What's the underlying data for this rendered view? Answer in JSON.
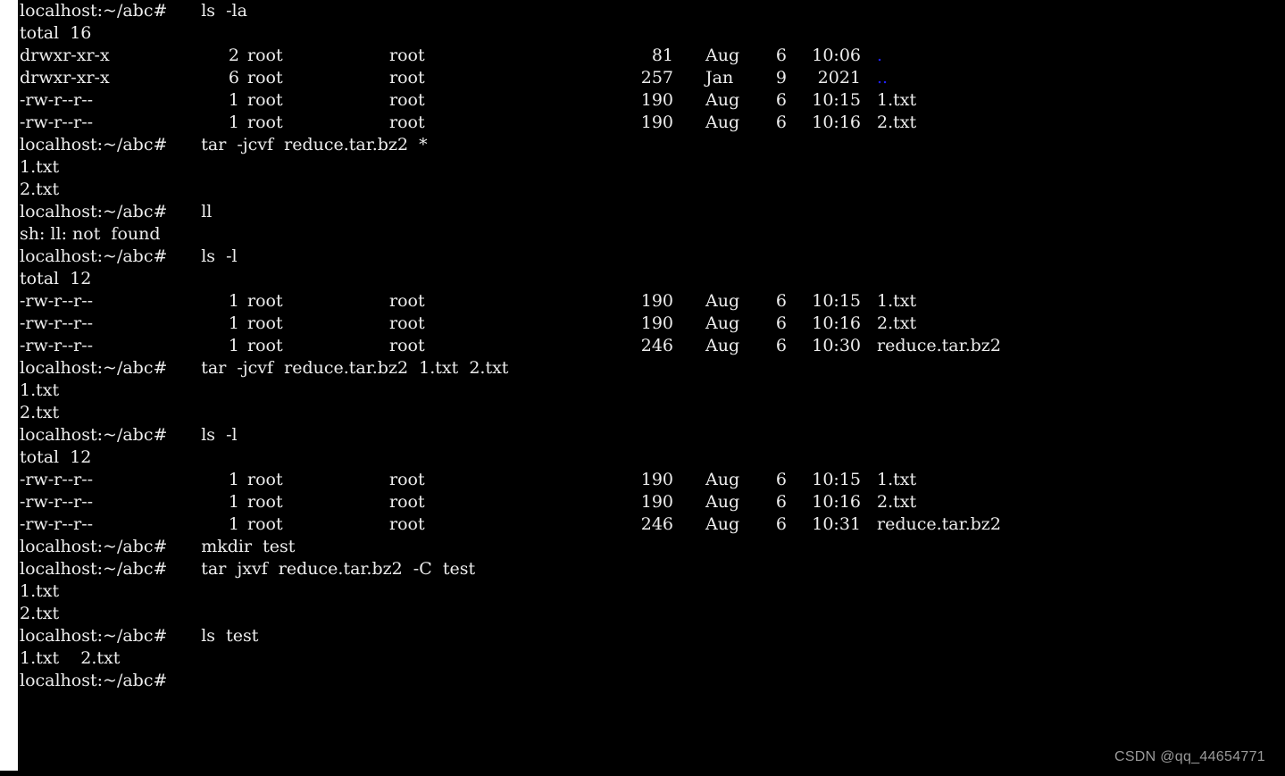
{
  "terminal": {
    "prompt": "localhost:~/abc# ",
    "colors": {
      "background": "#000000",
      "foreground": "#ededed",
      "directory": "#2222ff",
      "watermark": "#9a9a9a"
    },
    "watermark": "CSDN @qq_44654771",
    "lines": [
      {
        "type": "prompt",
        "command": " ls  -la"
      },
      {
        "type": "text",
        "text": "total  16"
      },
      {
        "type": "listing",
        "perm": "drwxr-xr-x",
        "links": "2",
        "owner": "root",
        "group": "root",
        "size": "81",
        "month": "Aug",
        "day": "6",
        "time": "10:06",
        "name": ".",
        "name_color": "directory"
      },
      {
        "type": "listing",
        "perm": "drwxr-xr-x",
        "links": "6",
        "owner": "root",
        "group": "root",
        "size": "257",
        "month": "Jan",
        "day": "9",
        "time": "2021",
        "name": "..",
        "name_color": "directory"
      },
      {
        "type": "listing",
        "perm": "-rw-r--r--",
        "links": "1",
        "owner": "root",
        "group": "root",
        "size": "190",
        "month": "Aug",
        "day": "6",
        "time": "10:15",
        "name": "1.txt",
        "name_color": "plain"
      },
      {
        "type": "listing",
        "perm": "-rw-r--r--",
        "links": "1",
        "owner": "root",
        "group": "root",
        "size": "190",
        "month": "Aug",
        "day": "6",
        "time": "10:16",
        "name": "2.txt",
        "name_color": "plain"
      },
      {
        "type": "prompt",
        "command": " tar  -jcvf  reduce.tar.bz2  *"
      },
      {
        "type": "text",
        "text": "1.txt"
      },
      {
        "type": "text",
        "text": "2.txt"
      },
      {
        "type": "prompt",
        "command": " ll"
      },
      {
        "type": "text",
        "text": "sh: ll: not  found"
      },
      {
        "type": "prompt",
        "command": " ls  -l"
      },
      {
        "type": "text",
        "text": "total  12"
      },
      {
        "type": "listing",
        "perm": "-rw-r--r--",
        "links": "1",
        "owner": "root",
        "group": "root",
        "size": "190",
        "month": "Aug",
        "day": "6",
        "time": "10:15",
        "name": "1.txt",
        "name_color": "plain"
      },
      {
        "type": "listing",
        "perm": "-rw-r--r--",
        "links": "1",
        "owner": "root",
        "group": "root",
        "size": "190",
        "month": "Aug",
        "day": "6",
        "time": "10:16",
        "name": "2.txt",
        "name_color": "plain"
      },
      {
        "type": "listing",
        "perm": "-rw-r--r--",
        "links": "1",
        "owner": "root",
        "group": "root",
        "size": "246",
        "month": "Aug",
        "day": "6",
        "time": "10:30",
        "name": "reduce.tar.bz2",
        "name_color": "plain"
      },
      {
        "type": "prompt",
        "command": " tar  -jcvf  reduce.tar.bz2  1.txt  2.txt"
      },
      {
        "type": "text",
        "text": "1.txt"
      },
      {
        "type": "text",
        "text": "2.txt"
      },
      {
        "type": "prompt",
        "command": " ls  -l"
      },
      {
        "type": "text",
        "text": "total  12"
      },
      {
        "type": "listing",
        "perm": "-rw-r--r--",
        "links": "1",
        "owner": "root",
        "group": "root",
        "size": "190",
        "month": "Aug",
        "day": "6",
        "time": "10:15",
        "name": "1.txt",
        "name_color": "plain"
      },
      {
        "type": "listing",
        "perm": "-rw-r--r--",
        "links": "1",
        "owner": "root",
        "group": "root",
        "size": "190",
        "month": "Aug",
        "day": "6",
        "time": "10:16",
        "name": "2.txt",
        "name_color": "plain"
      },
      {
        "type": "listing",
        "perm": "-rw-r--r--",
        "links": "1",
        "owner": "root",
        "group": "root",
        "size": "246",
        "month": "Aug",
        "day": "6",
        "time": "10:31",
        "name": "reduce.tar.bz2",
        "name_color": "plain"
      },
      {
        "type": "prompt",
        "command": " mkdir  test"
      },
      {
        "type": "prompt",
        "command": " tar  jxvf  reduce.tar.bz2  -C  test"
      },
      {
        "type": "text",
        "text": "1.txt"
      },
      {
        "type": "text",
        "text": "2.txt"
      },
      {
        "type": "prompt",
        "command": " ls  test"
      },
      {
        "type": "text",
        "text": "1.txt    2.txt"
      },
      {
        "type": "prompt",
        "command": ""
      }
    ]
  }
}
